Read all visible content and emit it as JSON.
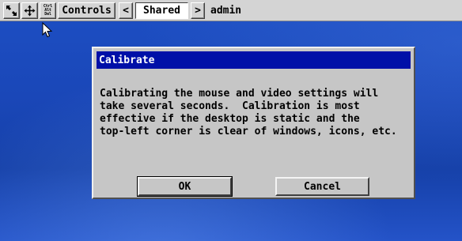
{
  "toolbar": {
    "icons": [
      "scale-icon",
      "move-icon",
      "ctrl-alt-del-icon"
    ],
    "cad_lines": [
      "Ctrl",
      "Alt",
      "Del"
    ],
    "controls_label": "Controls",
    "prev_label": "<",
    "session_label": "Shared",
    "next_label": ">",
    "user_label": "admin"
  },
  "dialog": {
    "title": "Calibrate",
    "body_lines": [
      "Calibrating the mouse and video settings will",
      "take several seconds.  Calibration is most",
      "effective if the desktop is static and the",
      "top-left corner is clear of windows, icons, etc."
    ],
    "ok_label": "OK",
    "cancel_label": "Cancel"
  },
  "colors": {
    "desktop": "#1d4fc4",
    "title_bar": "#0010a8",
    "dialog_bg": "#c6c6c6",
    "toolbar_bg": "#d4d4d4"
  }
}
